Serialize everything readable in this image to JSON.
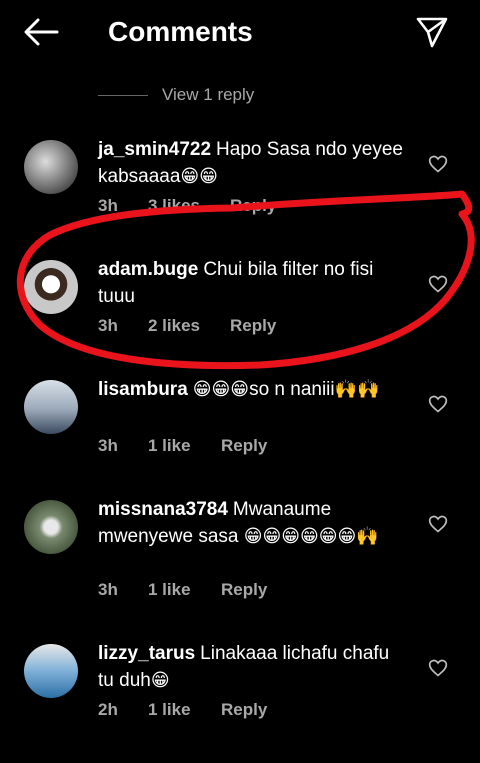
{
  "header": {
    "title": "Comments"
  },
  "view_reply": {
    "label": "View 1 reply"
  },
  "comments": [
    {
      "username": "ja_smin4722",
      "text": "Hapo Sasa ndo yeyee kabsaaaa",
      "emoji": "😁😁",
      "time": "3h",
      "likes": "3 likes",
      "reply": "Reply"
    },
    {
      "username": "adam.buge",
      "text": "Chui bila filter no fisi tuuu",
      "emoji": "",
      "time": "3h",
      "likes": "2 likes",
      "reply": "Reply"
    },
    {
      "username": "lisambura",
      "text": "so n naniii",
      "emoji_pre": "😁😁😁",
      "emoji": "🙌🙌",
      "time": "3h",
      "likes": "1 like",
      "reply": "Reply"
    },
    {
      "username": "missnana3784",
      "text": "Mwanaume mwenyewe sasa",
      "emoji": "😁😁😁😁😁😁🙌",
      "time": "3h",
      "likes": "1 like",
      "reply": "Reply"
    },
    {
      "username": "lizzy_tarus",
      "text": "Linakaaa lichafu chafu tu duh",
      "emoji": "😁",
      "time": "2h",
      "likes": "1 like",
      "reply": "Reply"
    }
  ],
  "colors": {
    "annotation": "#e8131b",
    "muted": "#a8a8a8"
  }
}
